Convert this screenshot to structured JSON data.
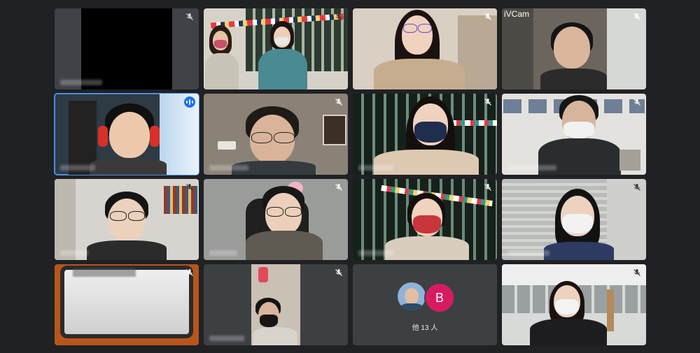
{
  "app": {
    "camera_label": "iVCam"
  },
  "others": {
    "avatar_letter": "B",
    "count_label": "他 13 人"
  },
  "colors": {
    "background": "#202124",
    "tile": "#3c4043",
    "active_outline": "#4a90e2",
    "avatar_b": "#d81b60"
  }
}
